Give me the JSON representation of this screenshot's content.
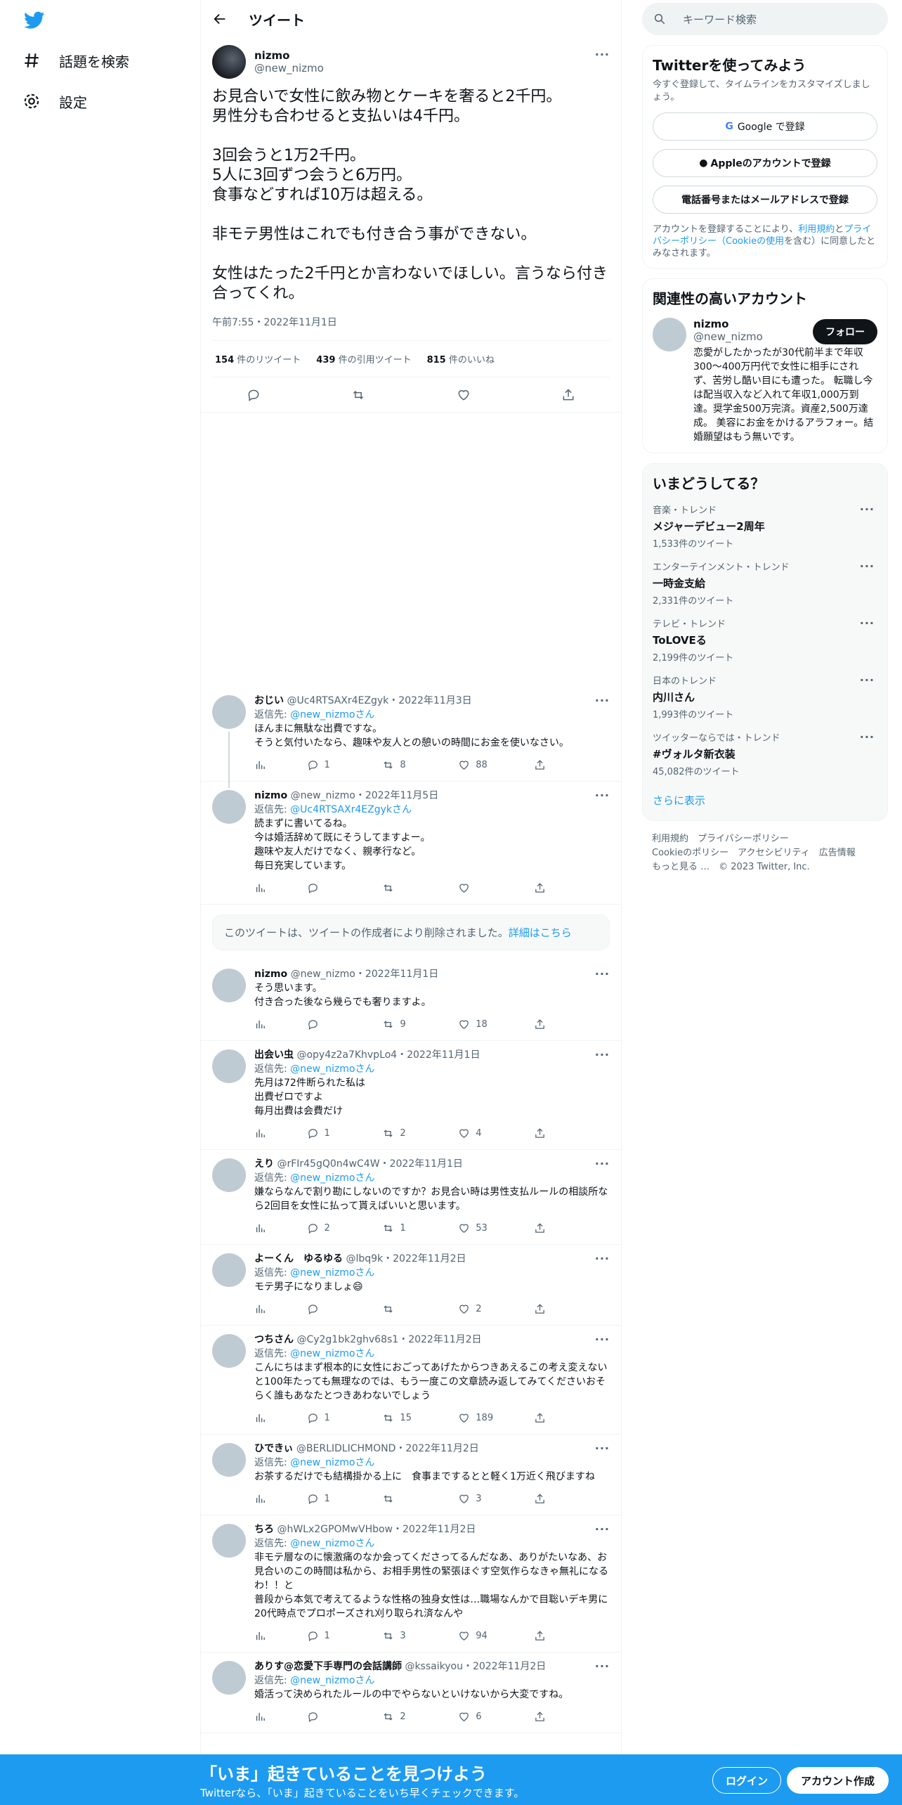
{
  "nav": {
    "explore": "話題を検索",
    "settings": "設定"
  },
  "header": {
    "title": "ツイート"
  },
  "tweet": {
    "name": "nizmo",
    "handle": "@new_nizmo",
    "text": "お見合いで女性に飲み物とケーキを奢ると2千円。\n男性分も合わせると支払いは4千円。\n\n3回会うと1万2千円。\n5人に3回ずつ会うと6万円。\n食事などすれば10万は超える。\n\n非モテ男性はこれでも付き合う事ができない。\n\n女性はたった2千円とか言わないでほしい。言うなら付き合ってくれ。",
    "time": "午前7:55・2022年11月1日",
    "retweets": "154",
    "retweets_label": "件のリツイート",
    "quotes": "439",
    "quotes_label": "件の引用ツイート",
    "likes": "815",
    "likes_label": "件のいいね"
  },
  "replies": [
    {
      "name": "おじい",
      "handle": "@Uc4RTSAXr4EZgyk",
      "date": "2022年11月3日",
      "to_label": "返信先: ",
      "to": "@new_nizmoさん",
      "text": "ほんまに無駄な出費ですな。\nそうと気付いたなら、趣味や友人との憩いの時間にお金を使いなさい。",
      "replies": "1",
      "retweets": "8",
      "likes": "88"
    },
    {
      "name": "nizmo",
      "handle": "@new_nizmo",
      "date": "2022年11月5日",
      "to_label": "返信先: ",
      "to": "@Uc4RTSAXr4EZgykさん",
      "text": "読まずに書いてるね。\n今は婚活辞めて既にそうしてますよー。\n趣味や友人だけでなく、親孝行など。\n毎日充実しています。",
      "replies": "",
      "retweets": "",
      "likes": ""
    },
    {
      "name": "nizmo",
      "handle": "@new_nizmo",
      "date": "2022年11月1日",
      "to_label": "",
      "to": "",
      "text": "そう思います。\n付き合った後なら幾らでも奢りますよ。",
      "replies": "",
      "retweets": "9",
      "likes": "18"
    },
    {
      "name": "出会い虫",
      "handle": "@opy4z2a7KhvpLo4",
      "date": "2022年11月1日",
      "to_label": "返信先: ",
      "to": "@new_nizmoさん",
      "text": "先月は72件断られた私は\n出費ゼロですよ\n毎月出費は会費だけ",
      "replies": "1",
      "retweets": "2",
      "likes": "4"
    },
    {
      "name": "えり",
      "handle": "@rFIr45gQ0n4wC4W",
      "date": "2022年11月1日",
      "to_label": "返信先: ",
      "to": "@new_nizmoさん",
      "text": "嫌ならなんで割り勘にしないのですか？お見合い時は男性支払ルールの相談所なら2回目を女性に払って貰えばいいと思います。",
      "replies": "2",
      "retweets": "1",
      "likes": "53"
    },
    {
      "name": "よーくん　ゆるゆる",
      "handle": "@lbq9k",
      "date": "2022年11月2日",
      "to_label": "返信先: ",
      "to": "@new_nizmoさん",
      "text": "モテ男子になりましょ😄",
      "replies": "",
      "retweets": "",
      "likes": "2"
    },
    {
      "name": "つちさん",
      "handle": "@Cy2g1bk2ghv68s1",
      "date": "2022年11月2日",
      "to_label": "返信先: ",
      "to": "@new_nizmoさん",
      "text": "こんにちはまず根本的に女性におごってあげたからつきあえるこの考え変えないと100年たっても無理なのでは、もう一度この文章読み返してみてくださいおそらく誰もあなたとつきあわないでしょう",
      "replies": "1",
      "retweets": "15",
      "likes": "189"
    },
    {
      "name": "ひできぃ",
      "handle": "@BERLIDLICHMOND",
      "date": "2022年11月2日",
      "to_label": "返信先: ",
      "to": "@new_nizmoさん",
      "text": "お茶するだけでも結構掛かる上に　食事までするとと軽く1万近く飛びますね",
      "replies": "1",
      "retweets": "",
      "likes": "3"
    },
    {
      "name": "ちろ",
      "handle": "@hWLx2GPOMwVHbow",
      "date": "2022年11月2日",
      "to_label": "返信先: ",
      "to": "@new_nizmoさん",
      "text": "非モテ層なのに懐激痛のなか会ってくださってるんだなあ、ありがたいなあ、お見合いのこの時間は私から、お相手男性の緊張ほぐす空気作らなきゃ無礼になるわ！！と\n普段から本気で考えてるような性格の独身女性は…職場なんかで目聡いデキ男に20代時点でプロポーズされ刈り取られ済なんや",
      "replies": "1",
      "retweets": "3",
      "likes": "94"
    },
    {
      "name": "ありす@恋愛下手専門の会話講師",
      "handle": "@kssaikyou",
      "date": "2022年11月2日",
      "to_label": "返信先: ",
      "to": "@new_nizmoさん",
      "text": "婚活って決められたルールの中でやらないといけないから大変ですね。",
      "replies": "",
      "retweets": "2",
      "likes": "6"
    }
  ],
  "deleted": {
    "text": "このツイートは、ツイートの作成者により削除されました。",
    "link": "詳細はこちら"
  },
  "search": {
    "placeholder": "キーワード検索"
  },
  "signup_card": {
    "title": "Twitterを使ってみよう",
    "subtitle": "今すぐ登録して、タイムラインをカスタマイズしましょう。",
    "google": "Google で登録",
    "apple": "Appleのアカウントで登録",
    "phone": "電話番号またはメールアドレスで登録",
    "legal_pre": "アカウントを登録することにより、",
    "terms": "利用規約",
    "and": "と",
    "privacy": "プライバシーポリシー（Cookieの使用",
    "legal_post": "を含む）に同意したとみなされます。"
  },
  "related": {
    "title": "関連性の高いアカウント",
    "name": "nizmo",
    "handle": "@new_nizmo",
    "follow": "フォロー",
    "bio": "恋愛がしたかったが30代前半まで年収300～400万円代で女性に相手にされず、苦労し酷い目にも遭った。 転職し今は配当収入など入れて年収1,000万到達。奨学金500万完済。資産2,500万達成。 美容にお金をかけるアラフォー。結婚願望はもう無いです。"
  },
  "trends": {
    "title": "いまどうしてる？",
    "items": [
      {
        "context": "音楽・トレンド",
        "name": "メジャーデビュー2周年",
        "count": "1,533件のツイート"
      },
      {
        "context": "エンターテインメント・トレンド",
        "name": "一時金支給",
        "count": "2,331件のツイート"
      },
      {
        "context": "テレビ・トレンド",
        "name": "ToLOVEる",
        "count": "2,199件のツイート"
      },
      {
        "context": "日本のトレンド",
        "name": "内川さん",
        "count": "1,993件のツイート"
      },
      {
        "context": "ツイッターならでは・トレンド",
        "name": "#ヴォルタ新衣装",
        "count": "45,082件のツイート"
      }
    ],
    "more": "さらに表示"
  },
  "footer": {
    "terms": "利用規約",
    "privacy": "プライバシーポリシー",
    "cookie": "Cookieのポリシー",
    "access": "アクセシビリティ",
    "ads": "広告情報",
    "more": "もっと見る …",
    "copyright": "© 2023 Twitter, Inc."
  },
  "bottom": {
    "title": "「いま」起きていることを見つけよう",
    "subtitle": "Twitterなら、「いま」起きていることをいち早くチェックできます。",
    "login": "ログイン",
    "signup": "アカウント作成"
  },
  "colors": {
    "accent": "#1d9bf0",
    "text": "#0f1419",
    "muted": "#536471"
  }
}
